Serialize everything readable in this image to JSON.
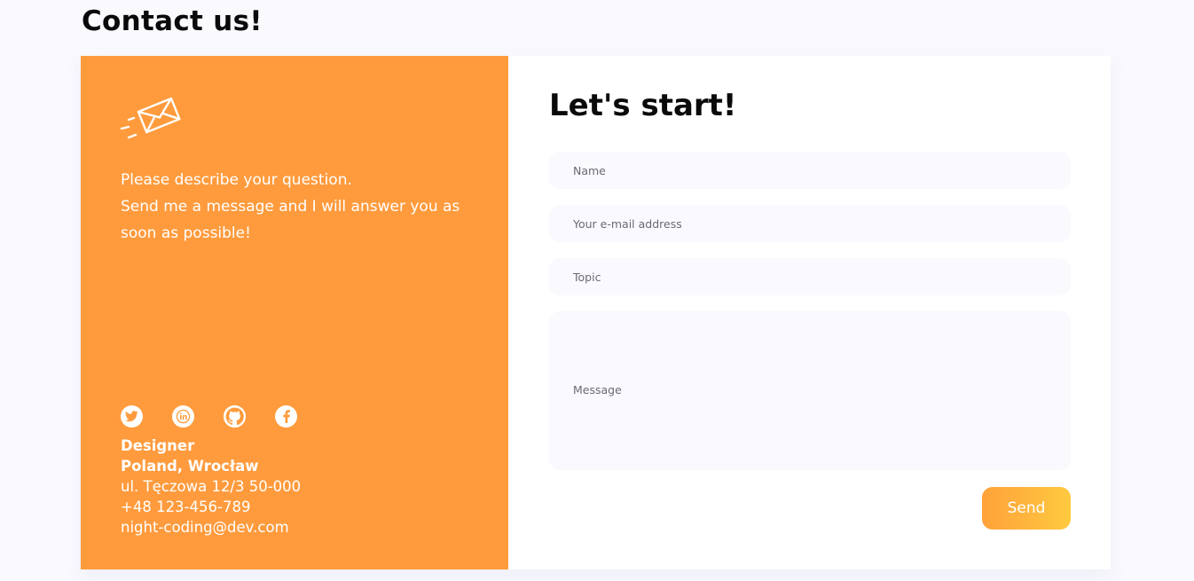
{
  "page": {
    "title": "Contact us!"
  },
  "info": {
    "icon": "envelope-icon",
    "intro_lines": [
      "Please describe your question.",
      "Send me a message and I will answer you as",
      "soon as possible!"
    ],
    "socials": [
      {
        "name": "twitter",
        "icon": "twitter-icon"
      },
      {
        "name": "linkedin",
        "icon": "linkedin-icon"
      },
      {
        "name": "github",
        "icon": "github-icon"
      },
      {
        "name": "facebook",
        "icon": "facebook-icon"
      }
    ],
    "role": "Designer",
    "location": "Poland, Wrocław",
    "street": "ul. Tęczowa 12/3 50-000",
    "phone": "+48 123-456-789",
    "email": "night-coding@dev.com"
  },
  "form": {
    "heading": "Let's start!",
    "name_placeholder": "Name",
    "email_placeholder": "Your e-mail address",
    "topic_placeholder": "Topic",
    "message_placeholder": "Message",
    "send_label": "Send"
  },
  "colors": {
    "accent_orange": "#ff9b3d",
    "send_gradient_start": "#ffa23a",
    "send_gradient_end": "#ffc93f",
    "page_background": "#f9f9fe",
    "field_background": "#f9f9fe"
  }
}
